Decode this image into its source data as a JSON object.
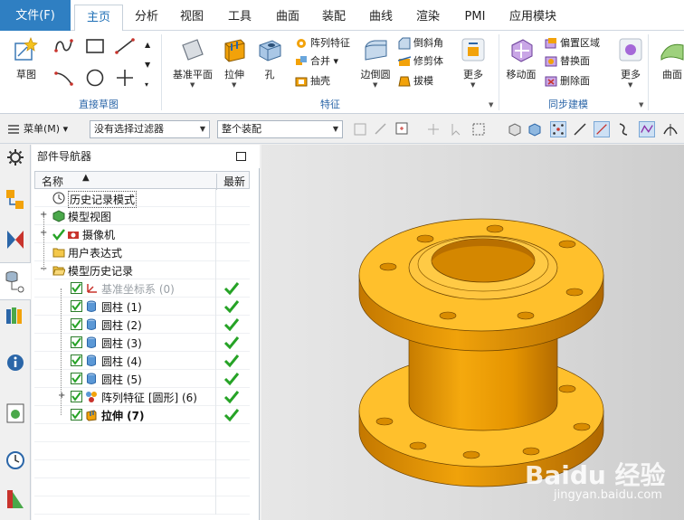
{
  "menu": {
    "tabs": [
      "文件(F)",
      "主页",
      "分析",
      "视图",
      "工具",
      "曲面",
      "装配",
      "曲线",
      "渲染",
      "PMI",
      "应用模块"
    ],
    "active": "主页"
  },
  "ribbon": {
    "sketch_label": "草图",
    "groups": {
      "direct_sketch": "直接草图",
      "feature": "特征",
      "sync_modeling": "同步建模"
    },
    "datum_plane": "基准平面",
    "extrude": "拉伸",
    "hole": "孔",
    "pattern_feature": "阵列特征",
    "unite": "合并",
    "shell": "抽壳",
    "edge_blend": "边倒圆",
    "chamfer": "倒斜角",
    "trim_body": "修剪体",
    "draft": "拔模",
    "more1": "更多",
    "move_face": "移动面",
    "offset_region": "偏置区域",
    "replace_face": "替换面",
    "delete_face": "删除面",
    "more2": "更多",
    "surface": "曲面"
  },
  "toolbar": {
    "menu_label": "菜单(M)",
    "filter": "没有选择过滤器",
    "assembly": "整个装配"
  },
  "navigator": {
    "title": "部件导航器",
    "col_name": "名称",
    "col_latest": "最新",
    "rows": [
      {
        "label": "历史记录模式",
        "style": "normal"
      },
      {
        "label": "模型视图",
        "style": "normal"
      },
      {
        "label": "摄像机",
        "style": "normal"
      },
      {
        "label": "用户表达式",
        "style": "normal"
      },
      {
        "label": "模型历史记录",
        "style": "normal"
      },
      {
        "label": "基准坐标系 (0)",
        "style": "grey"
      },
      {
        "label": "圆柱 (1)",
        "style": "normal"
      },
      {
        "label": "圆柱 (2)",
        "style": "normal"
      },
      {
        "label": "圆柱 (3)",
        "style": "normal"
      },
      {
        "label": "圆柱 (4)",
        "style": "normal"
      },
      {
        "label": "圆柱 (5)",
        "style": "normal"
      },
      {
        "label": "阵列特征 [圆形] (6)",
        "style": "normal"
      },
      {
        "label": "拉伸 (7)",
        "style": "bold"
      }
    ]
  },
  "watermark": {
    "brand": "Baidu 经验",
    "url": "jingyan.baidu.com"
  },
  "colors": {
    "file_tab": "#2f7fc2",
    "part_main": "#f2a20a",
    "part_light": "#ffc43a",
    "part_dark": "#b56e00",
    "check": "#26a326"
  }
}
